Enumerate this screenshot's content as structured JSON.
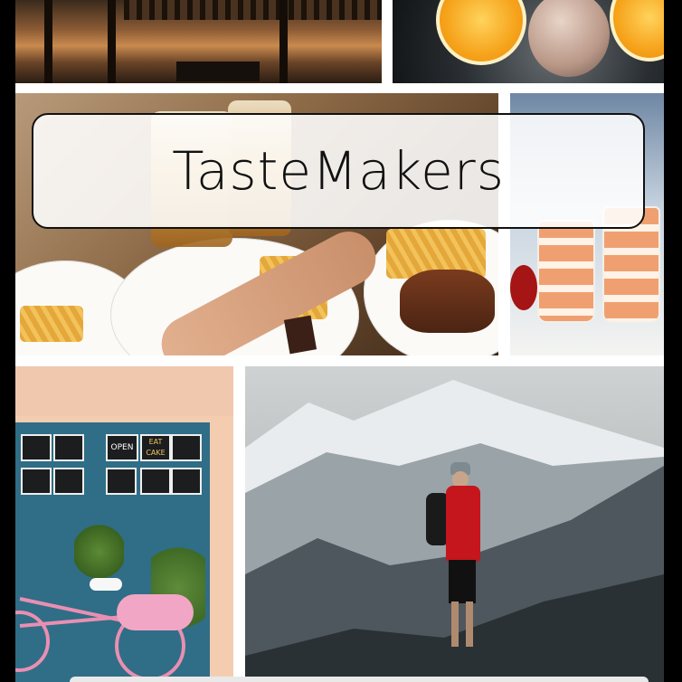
{
  "app": {
    "title": "TasteMakers"
  },
  "banner": {
    "title": "TasteMakers"
  },
  "collage": {
    "tiles": [
      {
        "name": "pier-sunset-photo",
        "icon": "photo-icon"
      },
      {
        "name": "orange-drink-photo",
        "icon": "photo-icon"
      },
      {
        "name": "burger-beer-photo",
        "icon": "photo-icon"
      },
      {
        "name": "milkshakes-photo",
        "icon": "photo-icon"
      },
      {
        "name": "cafe-storefront-photo",
        "icon": "photo-icon"
      },
      {
        "name": "mountain-hiker-photo",
        "icon": "photo-icon"
      }
    ],
    "cafe_signs": [
      "OPEN",
      "EAT",
      "CAKE"
    ]
  },
  "colors": {
    "background": "#000000",
    "gutter": "#ffffff",
    "banner_border": "#111111",
    "hiker_jacket": "#c4161c",
    "cafe_door": "#2f6e86",
    "bike": "#e98fb2"
  }
}
